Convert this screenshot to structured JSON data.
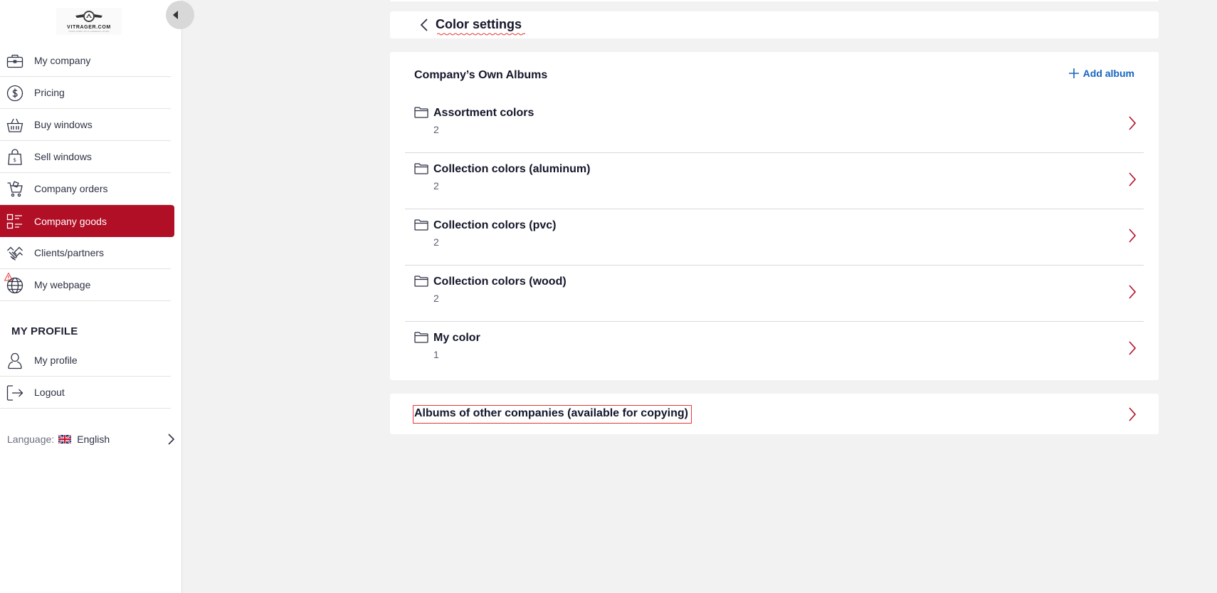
{
  "app": {
    "logo_text": "VITRAGER.COM",
    "logo_tagline": "OKNA DVERI DLYA VASHEGO DOMA"
  },
  "sidebar": {
    "items": [
      {
        "label": "My company",
        "icon": "briefcase-icon",
        "active": false
      },
      {
        "label": "Pricing",
        "icon": "dollar-circle-icon",
        "active": false
      },
      {
        "label": "Buy windows",
        "icon": "basket-icon",
        "active": false
      },
      {
        "label": "Sell windows",
        "icon": "shopping-bag-icon",
        "active": false
      },
      {
        "label": "Company orders",
        "icon": "cart-icon",
        "active": false
      },
      {
        "label": "Company goods",
        "icon": "list-icon",
        "active": true
      },
      {
        "label": "Clients/partners",
        "icon": "handshake-icon",
        "active": false
      },
      {
        "label": "My webpage",
        "icon": "globe-icon",
        "active": false
      }
    ],
    "profile_section_title": "MY PROFILE",
    "profile_items": [
      {
        "label": "My profile",
        "icon": "user-icon"
      },
      {
        "label": "Logout",
        "icon": "logout-icon"
      }
    ],
    "language": {
      "label": "Language:",
      "value": "English",
      "flag": "uk-flag-icon"
    }
  },
  "header": {
    "title": "Color settings"
  },
  "albums": {
    "title": "Company’s Own Albums",
    "add_label": "Add album",
    "items": [
      {
        "name": "Assortment colors",
        "count": "2"
      },
      {
        "name": "Collection colors (aluminum)",
        "count": "2"
      },
      {
        "name": "Collection colors (pvc)",
        "count": "2"
      },
      {
        "name": "Collection colors (wood)",
        "count": "2"
      },
      {
        "name": "My color",
        "count": "1"
      }
    ]
  },
  "other_albums": {
    "label": "Albums of other companies (available for copying)"
  },
  "colors": {
    "accent": "#b10f25",
    "link": "#1565c0",
    "background": "#f2f2f2"
  }
}
